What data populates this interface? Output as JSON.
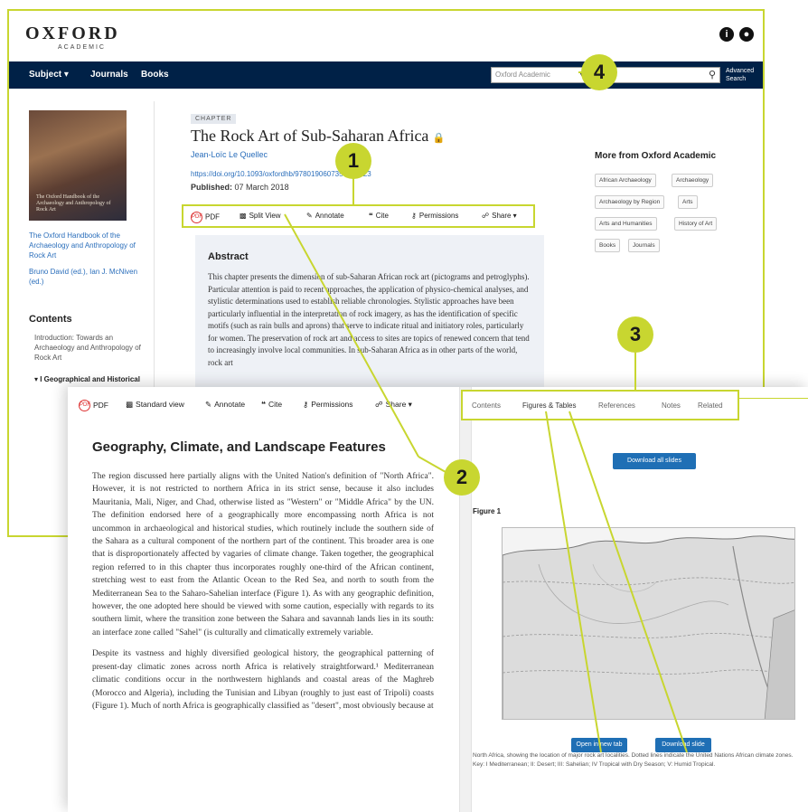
{
  "colors": {
    "accent": "#c8d630",
    "nav": "#002147",
    "link": "#2a6ebb",
    "button": "#1f6fb5"
  },
  "header": {
    "logo_main": "OXFORD",
    "logo_sub": "ACADEMIC",
    "icons": [
      "info-icon",
      "account-icon"
    ]
  },
  "nav": {
    "items": [
      "Subject ▾",
      "Journals",
      "Books"
    ],
    "search_scope": "Oxford Academic",
    "advanced": "Advanced Search"
  },
  "sidebar": {
    "book_cover_text": "The Oxford Handbook of the Archaeology and Anthropology of Rock Art",
    "book_link": "The Oxford Handbook of the Archaeology and Anthropology of Rock Art",
    "editors": "Bruno David (ed.), Ian J. McNiven (ed.)",
    "contents_title": "Contents",
    "toc": [
      "Introduction: Towards an Archaeology and Anthropology of Rock Art",
      "▾ I Geographical and Historical"
    ]
  },
  "article": {
    "tag": "CHAPTER",
    "title": "The Rock Art of Sub-Saharan Africa",
    "author": "Jean-Loïc Le Quellec",
    "doi": "https://doi.org/10.1093/oxfordhb/9780190607357.013.23",
    "published_label": "Published:",
    "published_date": "07 March 2018"
  },
  "toolbar": {
    "items": [
      "PDF",
      "Split View",
      "Annotate",
      "Cite",
      "Permissions",
      "Share ▾"
    ]
  },
  "abstract": {
    "heading": "Abstract",
    "text": "This chapter presents the dimension of sub-Saharan African rock art (pictograms and petroglyphs). Particular attention is paid to recent approaches, the application of physico-chemical analyses, and stylistic determinations used to establish reliable chronologies. Stylistic approaches have been particularly influential in the interpretation of rock imagery, as has the identification of specific motifs (such as rain bulls and aprons) that serve to indicate ritual and initiatory roles, particularly for women. The preservation of rock art and access to sites are topics of renewed concern that tend to increasingly involve local communities. In sub-Saharan Africa as in other parts of the world, rock art"
  },
  "more": {
    "heading": "More from Oxford Academic",
    "chips": [
      "African Archaeology",
      "Archaeology",
      "Archaeology by Region",
      "Arts",
      "Arts and Humanities",
      "History of Art",
      "Books",
      "Journals"
    ]
  },
  "reader": {
    "toolbar": [
      "PDF",
      "Standard view",
      "Annotate",
      "Cite",
      "Permissions",
      "Share ▾"
    ],
    "section_title": "Geography, Climate, and Landscape Features",
    "paragraph1": "The region discussed here partially aligns with the United Nation's definition of \"North Africa\". However, it is not restricted to northern Africa in its strict sense, because it also includes Mauritania, Mali, Niger, and Chad, otherwise listed as \"Western\" or \"Middle Africa\" by the UN. The definition endorsed here of a geographically more encompassing north Africa is not uncommon in archaeological and historical studies, which routinely include the southern side of the Sahara as a cultural component of the northern part of the continent. This broader area is one that is disproportionately affected by vagaries of climate change. Taken together, the geographical region referred to in this chapter thus incorporates roughly one-third of the African continent, stretching west to east from the Atlantic Ocean to the Red Sea, and north to south from the Mediterranean Sea to the Saharo-Sahelian interface (Figure 1). As with any geographic definition, however, the one adopted here should be viewed with some caution, especially with regards to its southern limit, where the transition zone between the Sahara and savannah lands lies in its south: an interface zone called \"Sahel\" (is culturally and climatically extremely variable.",
    "paragraph2": "Despite its vastness and highly diversified geological history, the geographical patterning of present-day climatic zones across north Africa is relatively straightforward.¹ Mediterranean climatic conditions occur in the northwestern highlands and coastal areas of the Maghreb (Morocco and Algeria), including the Tunisian and Libyan (roughly to just east of Tripoli) coasts (Figure 1). Much of north Africa is geographically classified as \"desert\", most obviously because at",
    "tabs": [
      "Contents",
      "Figures & Tables",
      "References",
      "Notes",
      "Related"
    ],
    "download_all": "Download all slides",
    "figure_label": "Figure 1",
    "open_new_tab": "Open in new tab",
    "download_slide": "Download slide",
    "caption": "North Africa, showing the location of major rock art localities. Dotted lines indicate the United Nations African climate zones. Key: I Mediterranean; II: Desert; III: Sahelian; IV Tropical with Dry Season; V: Humid Tropical."
  },
  "callouts": [
    "1",
    "2",
    "3",
    "4"
  ]
}
